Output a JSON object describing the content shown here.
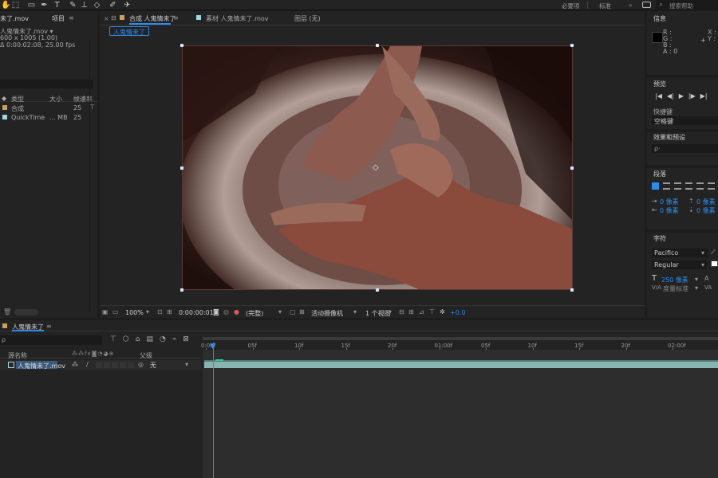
{
  "toolbar": {
    "workspaces": [
      "必要项",
      "标准"
    ],
    "search_help": "搜索帮助"
  },
  "project": {
    "tab_left": "未了.mov",
    "tab_label": "项目",
    "info_line1": "人鬼情未了.mov ▾",
    "info_line2": "600 x 1005 (1.00)",
    "info_line3": "Δ 0:00:02:08, 25.00 fps",
    "columns": {
      "type": "类型",
      "size": "大小",
      "fps": "帧速率"
    },
    "items": [
      {
        "type": "合成",
        "size": "",
        "fps": "25",
        "color": "#c8a060"
      },
      {
        "type": "QuickTime",
        "size": "... MB",
        "fps": "25",
        "color": "#9fd6e0"
      }
    ]
  },
  "comp": {
    "tabs": [
      "合成 人鬼情未了",
      "素材 人鬼情未了.mov",
      "图层 (无)"
    ],
    "active_subtab": "人鬼情未了",
    "footer": {
      "zoom": "100%",
      "timecode": "0:00:00:01",
      "resolution": "(完整)",
      "camera": "活动摄像机",
      "views": "1 个视图",
      "exposure": "+0.0"
    }
  },
  "info": {
    "title": "信息",
    "r": "R :",
    "g": "G :",
    "b": "B :",
    "a": "A : 0",
    "x": "X :",
    "y": "Y :"
  },
  "preview": {
    "title": "预览",
    "shortcut_label": "快捷键",
    "shortcut_value": "空格键"
  },
  "effects": {
    "title": "效果和预设",
    "search_prefix": "ρ·"
  },
  "paragraph": {
    "title": "段落",
    "fields": [
      "0 像素",
      "0 像素",
      "0 像素",
      "0 像素",
      "0 像素"
    ]
  },
  "character": {
    "title": "字符",
    "font": "Pacifico",
    "style": "Regular",
    "size": "250 像素",
    "tracking_label": "度量标准"
  },
  "timeline": {
    "tab": "人鬼情未了",
    "col_source": "源名称",
    "col_parent": "父级",
    "layer_name": "人鬼情未了.mov",
    "parent_value": "无",
    "ticks": [
      "0:00f",
      "05f",
      "10f",
      "15f",
      "20f",
      "01:00f",
      "05f",
      "10f",
      "15f",
      "20f",
      "02:00f"
    ]
  },
  "colors": {
    "accent": "#2d8ceb",
    "panel": "#232323",
    "bg": "#1d1d1d",
    "track": "#8ab4b0"
  }
}
